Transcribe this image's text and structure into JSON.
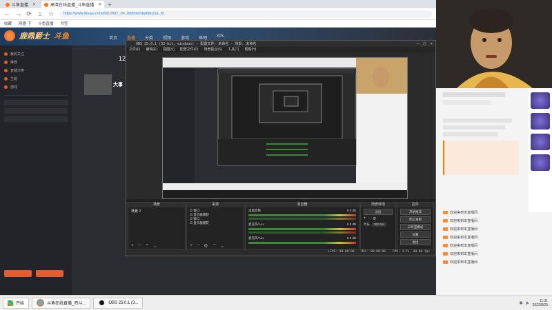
{
  "browser": {
    "tab_label": "斗鱼直播",
    "tab_active": "高清在线直播_斗鱼直播",
    "url": "https://www.douyu.com/6812837_rt=_0ddb9d1ba8dc2a1_fd",
    "bookmarks": [
      "收藏",
      "网盘·下",
      "斗鱼直播",
      "书签"
    ]
  },
  "site": {
    "logo": "斗鱼",
    "title_banner": "鹿鼎爵士",
    "nav": [
      "首页",
      "直播",
      "分类",
      "视频",
      "游戏",
      "鱼吧",
      "KPL"
    ],
    "sidebar": [
      "我的关注",
      "推荐",
      "直播分类",
      "主题",
      "游戏"
    ],
    "viewer_count": "12",
    "streamer": "大事"
  },
  "obs": {
    "title": "OBS 25.0.1 (32-bit, windows) - 配置文件: 未命名 - 场景: 未命名",
    "menu": [
      "文件(F)",
      "编辑(E)",
      "视图(V)",
      "配置文件(P)",
      "场景集合(S)",
      "工具(T)",
      "帮助(H)"
    ],
    "docks": {
      "scenes": {
        "title": "场景",
        "items": [
          "场景 2"
        ]
      },
      "sources": {
        "title": "来源",
        "items": [
          "窗口",
          "显示器捕获",
          "窗口",
          "显示器捕获"
        ]
      },
      "mixer": {
        "title": "混音器",
        "tracks": [
          {
            "name": "桌面音频",
            "db": "0.0 dB"
          },
          {
            "name": "麦克风/Aux",
            "db": "0.0 dB"
          },
          {
            "name": "麦克风/Aux",
            "db": "0.0 dB"
          }
        ]
      },
      "transitions": {
        "title": "场景转场",
        "type": "淡出",
        "duration_label": "时长",
        "duration": "300 ms"
      },
      "controls": {
        "title": "控件",
        "buttons": [
          "开始推流",
          "停止录制",
          "工作室模式",
          "设置",
          "退出"
        ]
      }
    },
    "status": [
      "LIVE: 00:00:00",
      "REC: 00:00:00",
      "CPU: 3.7%, 40.00 fps"
    ]
  },
  "chat": {
    "lines": [
      "欢迎来到本直播间",
      "欢迎来到本直播间",
      "欢迎来到本直播间",
      "欢迎来到本直播间",
      "欢迎来到本直播间",
      "欢迎来到本直播间",
      "欢迎来到本直播间"
    ]
  },
  "taskbar": {
    "start": "开始",
    "tasks": [
      "斗鱼在线直播_鸡斗...",
      "OBS 25.0.1 (3..."
    ],
    "time": "11:31",
    "date": "2022/8/25"
  },
  "colors": {
    "accent": "#ff7a00",
    "obs_bg": "#2b2b2b",
    "meter_green": "#3a8a3a"
  }
}
